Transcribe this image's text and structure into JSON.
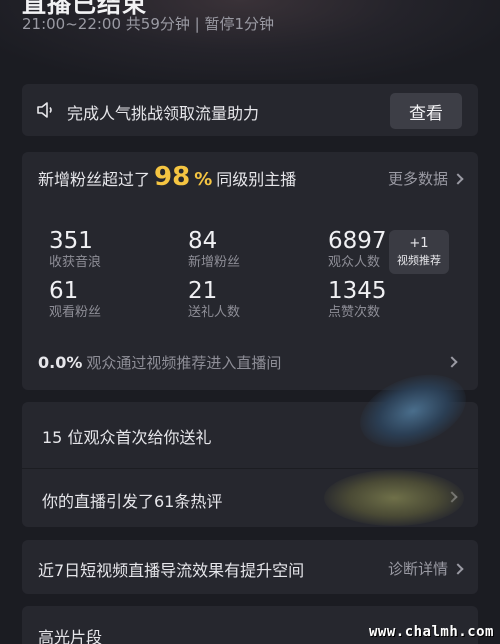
{
  "header": {
    "title": "直播已结束",
    "time_info": "21:00~22:00 共59分钟 | 暂停1分钟"
  },
  "notice": {
    "icon": "speaker-icon",
    "text": "完成人气挑战领取流量助力",
    "button_label": "查看"
  },
  "stats": {
    "head_prefix": "新增粉丝超过了",
    "head_percent": "98",
    "head_percent_sign": "%",
    "head_suffix": "同级别主播",
    "more_label": "更多数据",
    "items": [
      {
        "value": "351",
        "label": "收获音浪"
      },
      {
        "value": "84",
        "label": "新增粉丝"
      },
      {
        "value": "6897",
        "label": "观众人数"
      },
      {
        "value": "61",
        "label": "观看粉丝"
      },
      {
        "value": "21",
        "label": "送礼人数"
      },
      {
        "value": "1345",
        "label": "点赞次数"
      }
    ],
    "badge": {
      "line1": "+1",
      "line2": "视频推荐"
    },
    "footer_value": "0.0%",
    "footer_text": "观众通过视频推荐进入直播间"
  },
  "fans": {
    "row1": "15 位观众首次给你送礼",
    "row2": "你的直播引发了61条热评"
  },
  "guide": {
    "text": "近7日短视频直播导流效果有提升空间",
    "action_label": "诊断详情"
  },
  "highlight": {
    "title": "高光片段"
  },
  "watermark": {
    "text": "www.chalmh.com"
  },
  "colors": {
    "background": "#1b1c22",
    "card": "#26272e",
    "accent": "#f5c542",
    "muted_text": "#8e8e97"
  }
}
